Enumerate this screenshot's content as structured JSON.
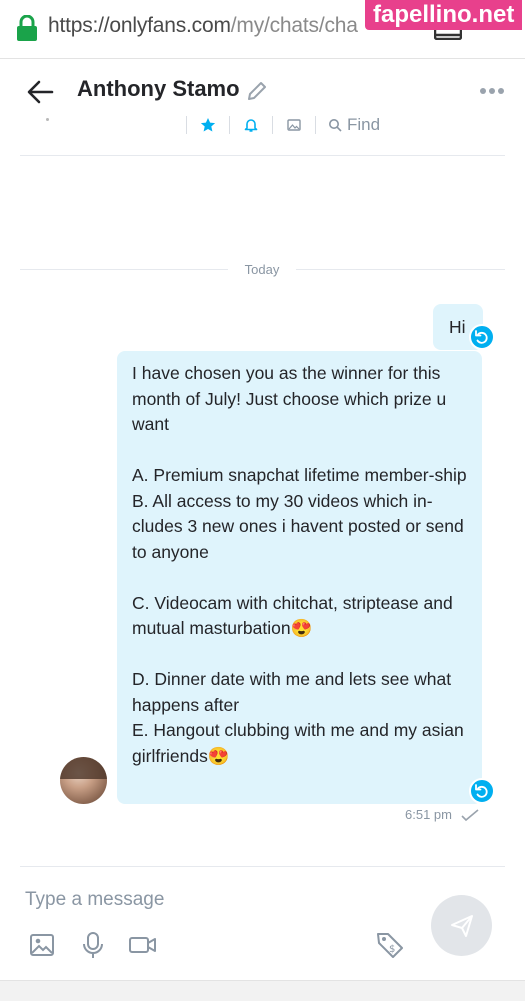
{
  "browser": {
    "url_main": "https://onlyfans.com",
    "url_path": "/my/chats/cha"
  },
  "watermark": "fapellino.net",
  "chat": {
    "contact_name": "Anthony Stamo",
    "find_label": "Find",
    "date_divider": "Today"
  },
  "messages": [
    {
      "text": "Hi"
    },
    {
      "text": "I have chosen you as the winner for this month of July! Just choose which prize u want\n\nA. Premium snapchat lifetime member-ship\nB. All access to my 30 videos which in-cludes 3 new ones i havent posted or send to anyone\n\nC. Videocam with chitchat, striptease and mutual masturbation😍\n\nD. Dinner date with me and lets see what happens after\nE. Hangout clubbing with me and my asian girlfriends😍"
    }
  ],
  "message_time": "6:51 pm",
  "composer": {
    "placeholder": "Type a message"
  },
  "colors": {
    "accent": "#00aff0",
    "bubble": "#dff4fc",
    "lock_green": "#1aa34a",
    "watermark_bg": "#e8408c"
  },
  "icons": [
    "lock-icon",
    "tabs-icon",
    "back-arrow-icon",
    "pencil-icon",
    "more-icon",
    "star-icon",
    "bell-icon",
    "image-icon",
    "search-icon",
    "undo-icon",
    "check-icon",
    "image-attach-icon",
    "microphone-icon",
    "video-icon",
    "price-tag-icon",
    "send-icon"
  ]
}
